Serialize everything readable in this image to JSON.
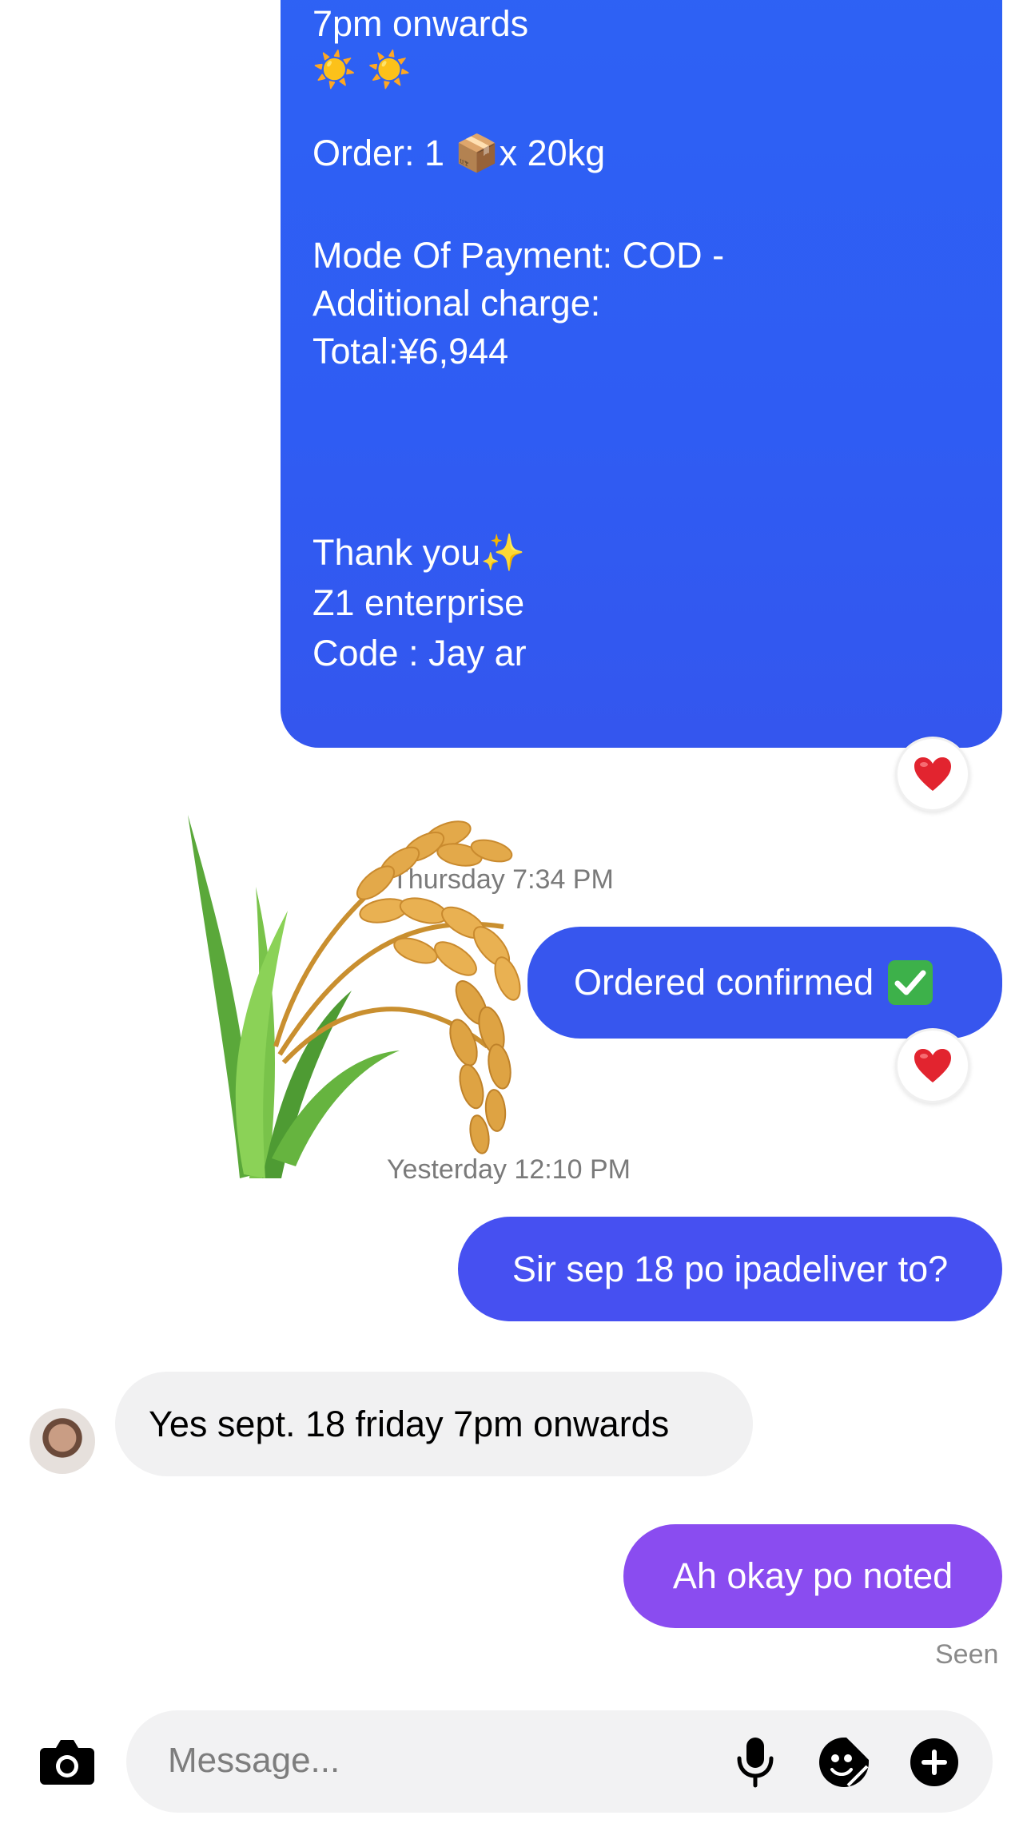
{
  "conversation": {
    "big_message": {
      "lines": [
        "7pm onwards",
        "☀️ ☀️",
        "Order: 1 ",
        "x 20kg",
        "Mode Of Payment: COD -",
        "Additional charge:",
        "Total:¥6,944",
        "Thank you",
        "Z1 enterprise",
        "Code : Jay ar"
      ],
      "package_icon": "package-emoji",
      "sparkles_icon": "sparkles-emoji"
    },
    "reaction_1": "❤️",
    "timestamp_1": "Thursday 7:34 PM",
    "msg_confirmed": "Ordered confirmed",
    "check_icon": "check-mark-button-emoji",
    "reaction_2": "❤️",
    "timestamp_2": "Yesterday 12:10 PM",
    "msg_question": "Sir sep 18 po ipadeliver to?",
    "msg_reply": "Yes sept. 18 friday 7pm onwards",
    "msg_noted": "Ah okay po noted",
    "seen": "Seen",
    "sticker": "rice-sheaf-sticker"
  },
  "composer": {
    "placeholder": "Message...",
    "camera_icon": "camera-icon",
    "mic_icon": "microphone-icon",
    "sticker_icon": "sticker-icon",
    "plus_icon": "plus-icon"
  },
  "colors": {
    "bubble_blue": "#2f5cf3",
    "bubble_indigo": "#4650f1",
    "bubble_purple": "#8a4cf0",
    "incoming_gray": "#f1f1f2"
  }
}
